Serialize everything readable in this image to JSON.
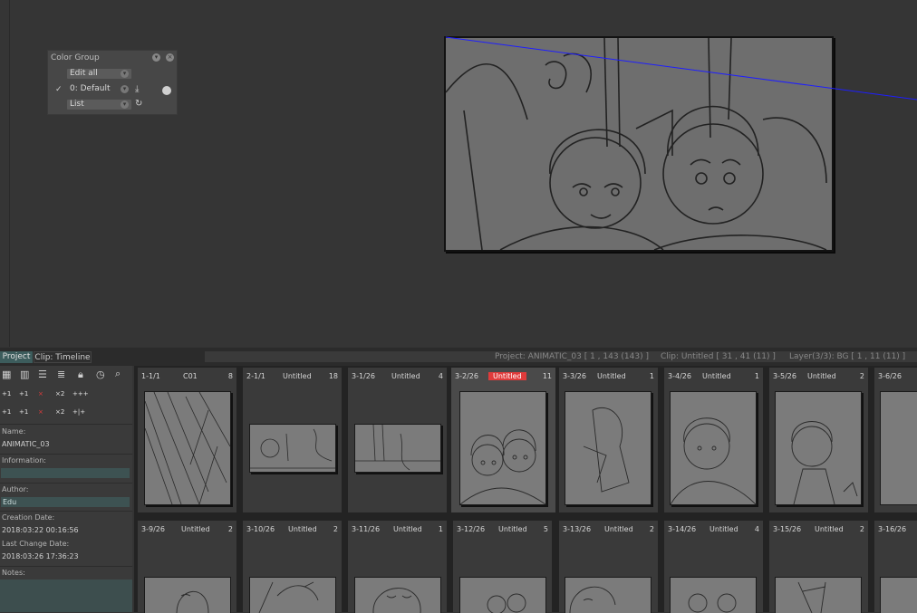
{
  "color_group": {
    "title": "Color Group",
    "edit_all": "Edit all",
    "default": "0: Default",
    "list": "List"
  },
  "tabs": {
    "project": "Project",
    "clip": "Clip: Timeline"
  },
  "status": {
    "project": "Project: ANIMATIC_03 [ 1 , 143  (143) ]",
    "clip": "Clip: Untitled [ 31 , 41  (11) ]",
    "layer": "Layer(3/3): BG [ 1 , 11  (11) ]"
  },
  "left_panel": {
    "name_label": "Name:",
    "name_value": "ANIMATIC_03",
    "information_label": "Information:",
    "author_label": "Author:",
    "author_value": "Edu",
    "creation_label": "Creation Date:",
    "creation_value": "2018:03:22 00:16:56",
    "change_label": "Last Change Date:",
    "change_value": "2018:03:26 17:36:23",
    "notes_label": "Notes:",
    "toolbar_row1": [
      "+1",
      "+1",
      "×",
      "×2",
      "+++"
    ],
    "toolbar_row2": [
      "+1",
      "+1",
      "×",
      "×2",
      "+|+"
    ]
  },
  "row1": [
    {
      "num": "1-1/1",
      "title": "C01",
      "count": "8"
    },
    {
      "num": "2-1/1",
      "title": "Untitled",
      "count": "18"
    },
    {
      "num": "3-1/26",
      "title": "Untitled",
      "count": "4"
    },
    {
      "num": "3-2/26",
      "title": "Untitled",
      "count": "11"
    },
    {
      "num": "3-3/26",
      "title": "Untitled",
      "count": "1"
    },
    {
      "num": "3-4/26",
      "title": "Untitled",
      "count": "1"
    },
    {
      "num": "3-5/26",
      "title": "Untitled",
      "count": "2"
    },
    {
      "num": "3-6/26",
      "title": "",
      "count": ""
    }
  ],
  "row2": [
    {
      "num": "3-9/26",
      "title": "Untitled",
      "count": "2"
    },
    {
      "num": "3-10/26",
      "title": "Untitled",
      "count": "2"
    },
    {
      "num": "3-11/26",
      "title": "Untitled",
      "count": "1"
    },
    {
      "num": "3-12/26",
      "title": "Untitled",
      "count": "5"
    },
    {
      "num": "3-13/26",
      "title": "Untitled",
      "count": "2"
    },
    {
      "num": "3-14/26",
      "title": "Untitled",
      "count": "4"
    },
    {
      "num": "3-15/26",
      "title": "Untitled",
      "count": "2"
    },
    {
      "num": "3-16/26",
      "title": "",
      "count": ""
    }
  ],
  "colors": {
    "accent": "#e03b3b",
    "tab": "#3c5c5c",
    "field": "#3d5252",
    "guide": "#1e1eff"
  }
}
